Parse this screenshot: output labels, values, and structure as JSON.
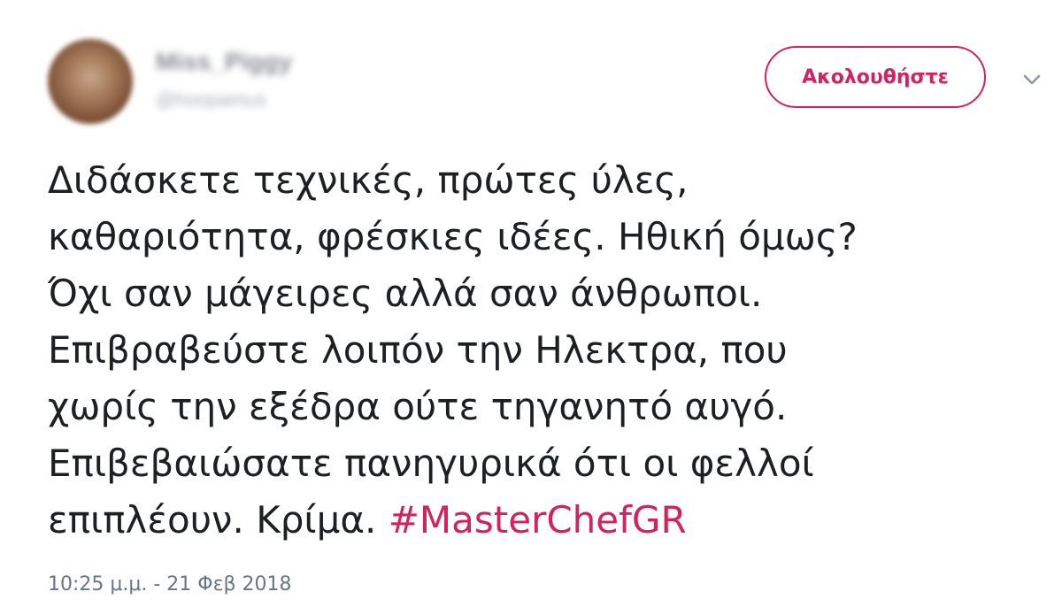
{
  "user": {
    "display_name": "Miss_Piggy",
    "handle": "@hoopamus"
  },
  "follow_button_label": "Ακολουθήστε",
  "more_icon": "chevron-down-icon",
  "tweet": {
    "lines": [
      "Διδάσκετε τεχνικές, πρώτες ύλες,",
      "καθαριότητα, φρέσκιες ιδέες. Ηθική όμως?",
      "Όχι σαν μάγειρες αλλά σαν άνθρωποι.",
      "Επιβραβεύστε λοιπόν την Ηλεκτρα, που",
      "χωρίς την εξέδρα ούτε τηγανητό αυγό.",
      "Επιβεβαιώσατε πανηγυρικά ότι οι φελλοί"
    ],
    "last_line_text": "επιπλέουν. Κρίμα. ",
    "hashtag": "#MasterChefGR"
  },
  "timestamp": "10:25 μ.μ. - 21 Φεβ 2018",
  "colors": {
    "accent": "#d1235f",
    "text": "#1c2022",
    "muted": "#657786"
  }
}
